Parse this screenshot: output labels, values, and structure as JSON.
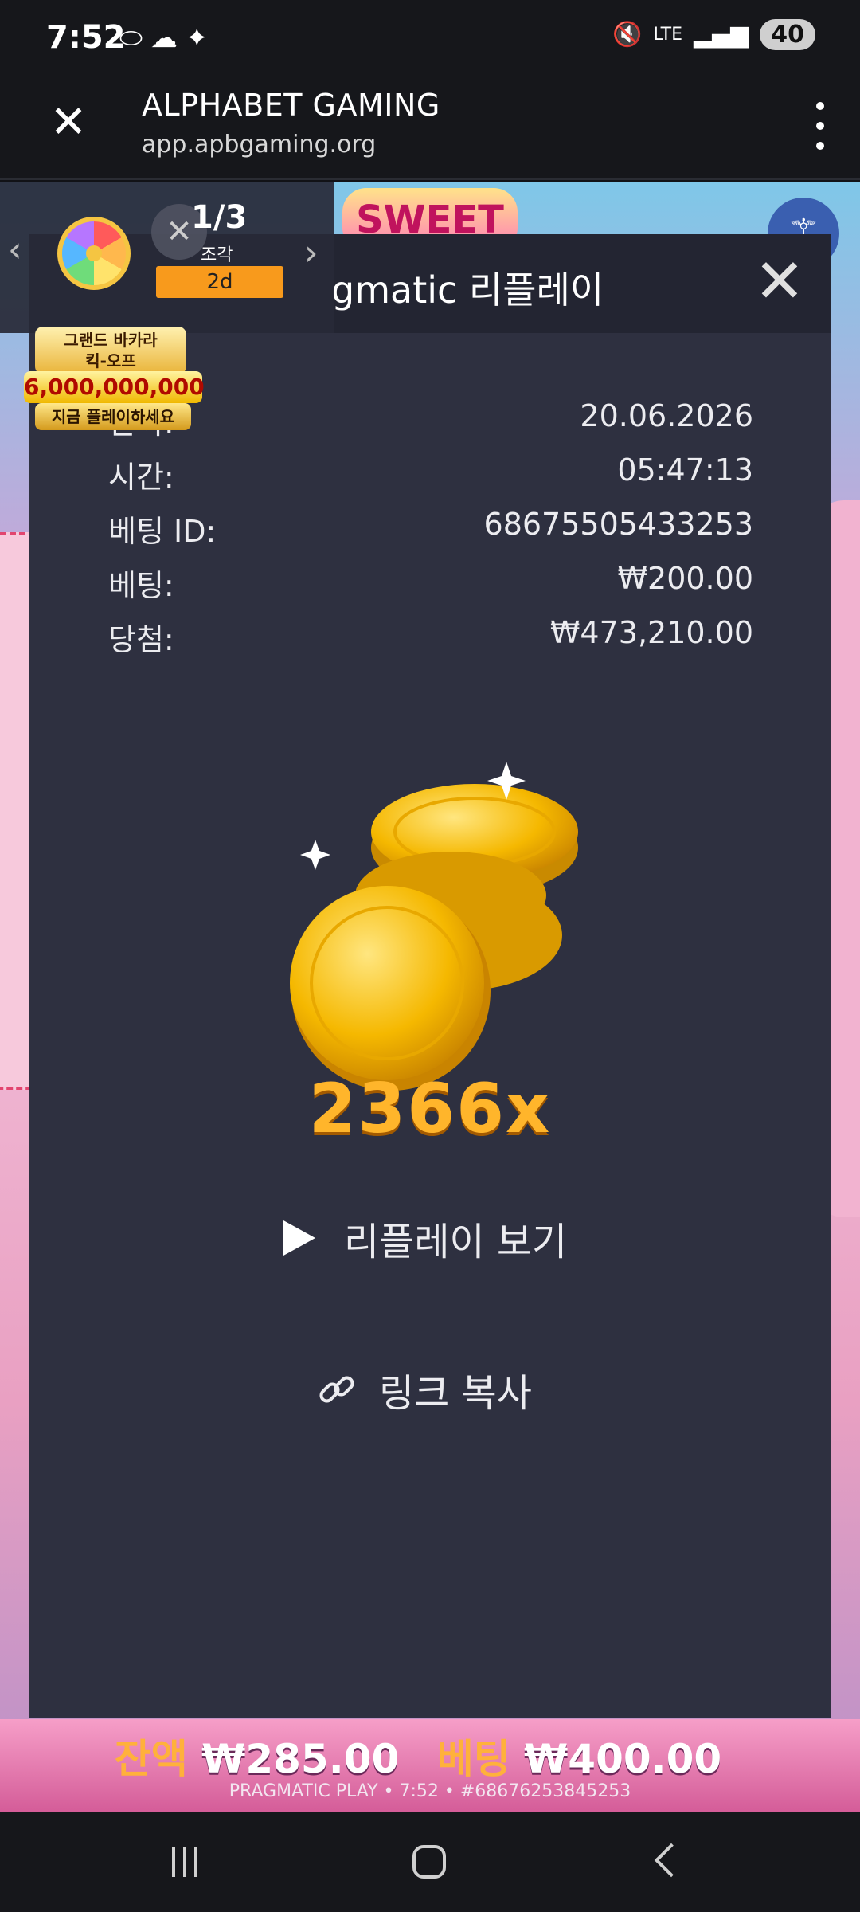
{
  "status_bar": {
    "time": "7:52",
    "battery": "40",
    "network": "LTE"
  },
  "browser": {
    "title": "ALPHABET GAMING",
    "url": "app.apbgaming.org"
  },
  "game": {
    "logo_text": "SWEET",
    "balance_label": "잔액",
    "balance_value": "₩285.00",
    "bet_label": "베팅",
    "bet_value": "₩400.00",
    "footer": "PRAGMATIC PLAY • 7:52 • #68676253845253"
  },
  "promo": {
    "count": "1/3",
    "sub_label": "조각",
    "badge": "2d",
    "baccarat_title_line1": "그랜드 바카라",
    "baccarat_title_line2": "킥-오프",
    "baccarat_amount": "6,000,000,000원",
    "baccarat_cta": "지금 플레이하세요"
  },
  "modal": {
    "title": "gmatic 리플레이",
    "rows": [
      {
        "label": "날짜:",
        "value": "20.06.2026"
      },
      {
        "label": "시간:",
        "value": "05:47:13"
      },
      {
        "label": "베팅 ID:",
        "value": "68675505433253"
      },
      {
        "label": "베팅:",
        "value": "₩200.00"
      },
      {
        "label": "당첨:",
        "value": "₩473,210.00"
      }
    ],
    "multiplier": "2366x",
    "replay_label": "리플레이 보기",
    "copy_label": "링크 복사"
  }
}
